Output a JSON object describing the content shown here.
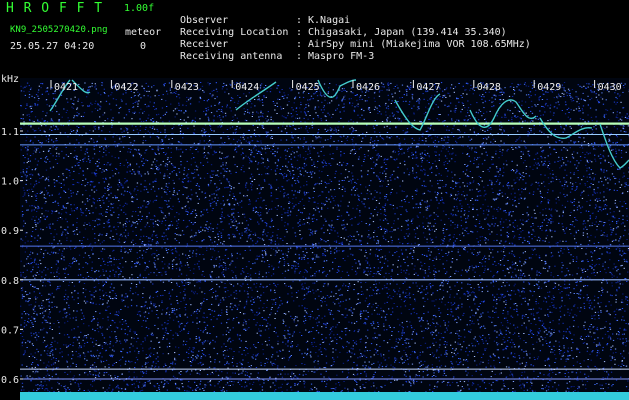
{
  "header": {
    "logo": "H R O F F T",
    "version": "1.00f",
    "filename": "KN9_2505270420.png",
    "meteor_label": "meteor",
    "datetime": "25.05.27 04:20",
    "meteor_count": "0"
  },
  "info": [
    {
      "label": "Observer",
      "value": "K.Nagai"
    },
    {
      "label": "Receiving Location",
      "value": "Chigasaki, Japan (139.414 35.340)"
    },
    {
      "label": "Receiver",
      "value": "AirSpy mini (Miakejima VOR 108.65MHz)"
    },
    {
      "label": "Receiving antenna",
      "value": "Maspro FM-3"
    }
  ],
  "axis_unit": "kHz",
  "y_ticks": [
    "1.1",
    "1.0",
    "0.9",
    "0.8",
    "0.7",
    "0.6"
  ],
  "time_labels": [
    "0421",
    "0422",
    "0423",
    "0424",
    "0425",
    "0426",
    "0427",
    "0428",
    "0429",
    "0430"
  ],
  "colors": {
    "background": "#000000",
    "noise_blue": "#1f3fd9",
    "carrier": "#aaffaa",
    "trace": "#44cccc",
    "header_green": "#33ff33",
    "text": "#e8e8e8"
  }
}
